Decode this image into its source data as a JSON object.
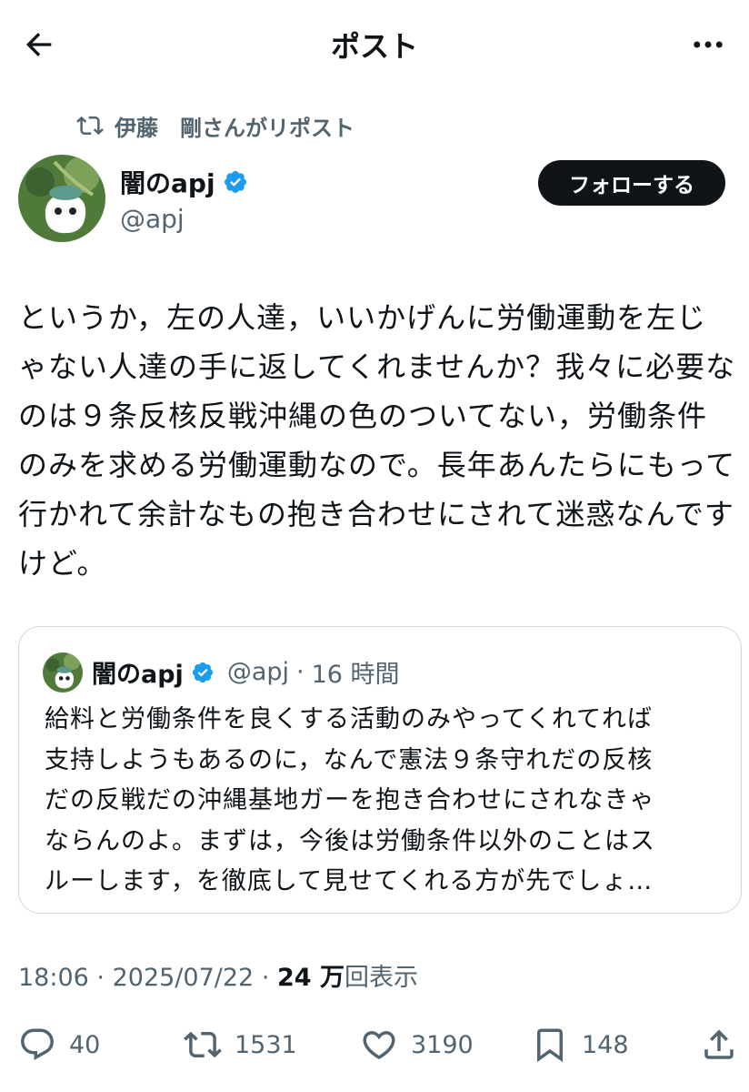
{
  "header": {
    "title": "ポスト"
  },
  "repost": {
    "text": "伊藤　剛さんがリポスト"
  },
  "author": {
    "name": "闇のapj",
    "handle": "@apj",
    "follow_label": "フォローする"
  },
  "post": {
    "text": "というか，左の人達，いいかげんに労働運動を左じゃない人達の手に返してくれませんか？我々に必要なのは９条反核反戦沖縄の色のついてない，労働条件のみを求める労働運動なので。長年あんたらにもって行かれて余計なもの抱き合わせにされて迷惑なんですけど。"
  },
  "quote": {
    "name": "闇のapj",
    "handle": "@apj",
    "separator": "·",
    "time": "16 時間",
    "text": "給料と労働条件を良くする活動のみやってくれてれば\n支持しようもあるのに，なんで憲法９条守れだの反核\nだの反戦だの沖縄基地ガーを抱き合わせにされなきゃ\nならんのよ。まずは，今後は労働条件以外のことはス\nルーします，を徹底して見せてくれる方が先でしょ…"
  },
  "meta": {
    "time": "18:06",
    "separator": "·",
    "date": "2025/07/22",
    "views_count": "24 万",
    "views_label": "回表示"
  },
  "actions": {
    "replies": "40",
    "reposts": "1531",
    "likes": "3190",
    "bookmarks": "148"
  },
  "colors": {
    "text": "#0f1419",
    "secondary": "#536471",
    "verified": "#1d9bf0",
    "border": "#cfd9de"
  }
}
